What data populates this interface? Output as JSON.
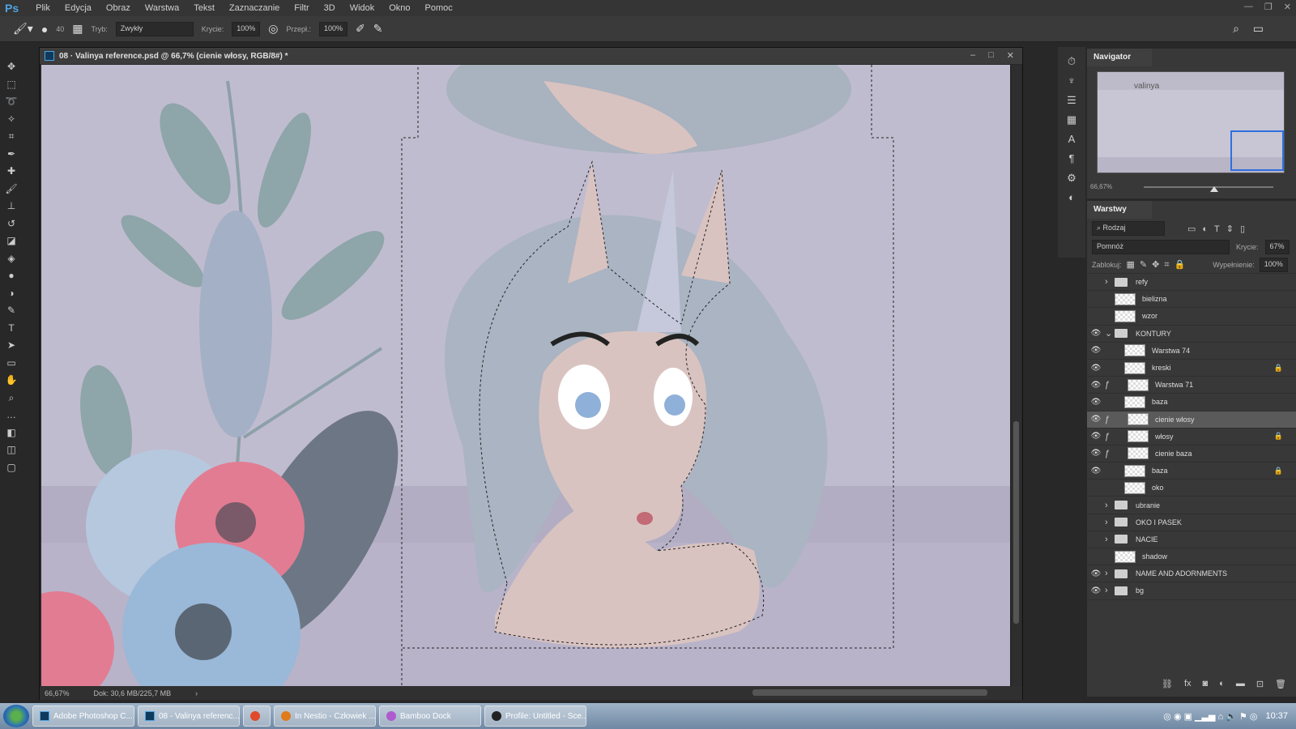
{
  "app": {
    "logo": "Ps",
    "menu": [
      "Plik",
      "Edycja",
      "Obraz",
      "Warstwa",
      "Tekst",
      "Zaznaczanie",
      "Filtr",
      "3D",
      "Widok",
      "Okno",
      "Pomoc"
    ]
  },
  "options": {
    "brush_size": "40",
    "mode_label": "Tryb:",
    "mode_value": "Zwykły",
    "opacity_label": "Krycie:",
    "opacity_value": "100%",
    "flow_label": "Przepł.:",
    "flow_value": "100%"
  },
  "document": {
    "title": "08 · Valinya reference.psd @ 66,7% (cienie włosy, RGB/8#) *",
    "zoom": "66,67%",
    "doc_info": "Dok: 30,6 MB/225,7 MB"
  },
  "navigator": {
    "tab": "Navigator",
    "zoom": "66,67%",
    "thumb_text": "valinya"
  },
  "layers": {
    "tab": "Warstwy",
    "filter": "Rodzaj",
    "blend_mode": "Pomnóż",
    "opacity_label": "Krycie:",
    "opacity_value": "67%",
    "lock_label": "Zablokuj:",
    "fill_label": "Wypełnienie:",
    "fill_value": "100%",
    "items": [
      {
        "name": "refy",
        "type": "folder",
        "visible": false,
        "indent": 1
      },
      {
        "name": "bielizna",
        "type": "layer",
        "visible": false,
        "indent": 1
      },
      {
        "name": "wzor",
        "type": "layer",
        "visible": false,
        "indent": 1
      },
      {
        "name": "KONTURY",
        "type": "folder-open",
        "visible": true,
        "indent": 1
      },
      {
        "name": "Warstwa 74",
        "type": "layer",
        "visible": true,
        "indent": 2
      },
      {
        "name": "kreski",
        "type": "layer",
        "visible": true,
        "indent": 2,
        "locked": true
      },
      {
        "name": "Warstwa 71",
        "type": "clip",
        "visible": true,
        "indent": 2
      },
      {
        "name": "baza",
        "type": "layer",
        "visible": true,
        "indent": 2
      },
      {
        "name": "cienie włosy",
        "type": "clip",
        "visible": true,
        "indent": 2,
        "selected": true
      },
      {
        "name": "włosy",
        "type": "clip",
        "visible": true,
        "indent": 2,
        "locked": true
      },
      {
        "name": "cienie baza",
        "type": "clip",
        "visible": true,
        "indent": 2
      },
      {
        "name": "baza",
        "type": "layer",
        "visible": true,
        "indent": 2,
        "locked": true
      },
      {
        "name": "oko",
        "type": "layer",
        "visible": false,
        "indent": 2
      },
      {
        "name": "ubranie",
        "type": "folder",
        "visible": false,
        "indent": 1
      },
      {
        "name": "OKO I PASEK",
        "type": "folder",
        "visible": false,
        "indent": 1
      },
      {
        "name": "NACIE",
        "type": "folder",
        "visible": false,
        "indent": 1
      },
      {
        "name": "shadow",
        "type": "layer",
        "visible": false,
        "indent": 1
      },
      {
        "name": "NAME AND ADORNMENTS",
        "type": "folder",
        "visible": true,
        "indent": 1
      },
      {
        "name": "bg",
        "type": "folder",
        "visible": true,
        "indent": 1
      }
    ]
  },
  "taskbar": {
    "items": [
      "Adobe Photoshop C...",
      "08 - Valinya referenc...",
      "",
      "In Nestio - Człowiek ...",
      "Bamboo Dock",
      "Profile: Untitled - Sce..."
    ],
    "clock": "10:37"
  },
  "colors": {
    "canvas_bg": "#c0bccf",
    "accent": "#4fa3e0",
    "flower_pink": "#e27c92",
    "flower_blue": "#9ab8d8",
    "hair": "#aab4c2",
    "skin": "#d9c3c0"
  }
}
